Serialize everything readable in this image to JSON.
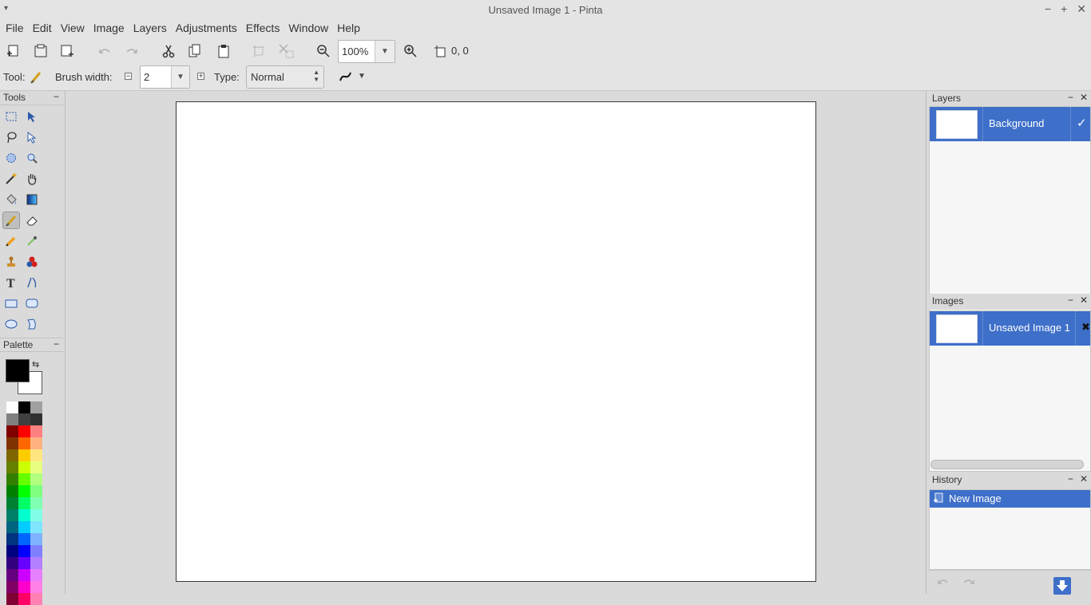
{
  "window": {
    "title": "Unsaved Image 1 - Pinta",
    "menu_arrow": "▾",
    "min": "−",
    "max": "+",
    "close": "✕"
  },
  "menubar": [
    "File",
    "Edit",
    "View",
    "Image",
    "Layers",
    "Adjustments",
    "Effects",
    "Window",
    "Help"
  ],
  "toolbar": {
    "zoom_value": "100%",
    "zoom_drop": "▼",
    "coordinates": "0, 0"
  },
  "options": {
    "tool_label": "Tool:",
    "brush_width_label": "Brush width:",
    "brush_width_value": "2",
    "brush_drop": "▼",
    "minus": "−",
    "plus": "+",
    "type_label": "Type:",
    "type_value": "Normal",
    "antialias_drop": "▼"
  },
  "tools_panel": {
    "title": "Tools",
    "minimize": "−"
  },
  "palette_panel": {
    "title": "Palette",
    "minimize": "−",
    "primary_color": "#000000",
    "secondary_color": "#ffffff",
    "colors": [
      [
        "#ffffff",
        "#000000",
        "#a0a0a0"
      ],
      [
        "#808080",
        "#404040",
        "#303030"
      ],
      [
        "#800000",
        "#ff0000",
        "#ff8080"
      ],
      [
        "#803300",
        "#ff6600",
        "#ffb380"
      ],
      [
        "#806600",
        "#ffcc00",
        "#ffe680"
      ],
      [
        "#668000",
        "#ccff00",
        "#e6ff80"
      ],
      [
        "#338000",
        "#66ff00",
        "#b3ff80"
      ],
      [
        "#008000",
        "#00ff00",
        "#80ff80"
      ],
      [
        "#008033",
        "#00ff66",
        "#80ffb3"
      ],
      [
        "#008066",
        "#00ffcc",
        "#80ffe6"
      ],
      [
        "#006680",
        "#00ccff",
        "#80e6ff"
      ],
      [
        "#003380",
        "#0066ff",
        "#80b3ff"
      ],
      [
        "#000080",
        "#0000ff",
        "#8080ff"
      ],
      [
        "#330080",
        "#6600ff",
        "#b380ff"
      ],
      [
        "#660080",
        "#cc00ff",
        "#e680ff"
      ],
      [
        "#800066",
        "#ff00cc",
        "#ff80e6"
      ],
      [
        "#800033",
        "#ff0066",
        "#ff80b3"
      ]
    ]
  },
  "layers_panel": {
    "title": "Layers",
    "minimize": "−",
    "close": "✕",
    "layer_name": "Background",
    "visible_check": "✓"
  },
  "images_panel": {
    "title": "Images",
    "minimize": "−",
    "close": "✕",
    "image_name": "Unsaved Image 1",
    "close_image": "✖"
  },
  "history_panel": {
    "title": "History",
    "minimize": "−",
    "close": "✕",
    "item": "New Image"
  }
}
